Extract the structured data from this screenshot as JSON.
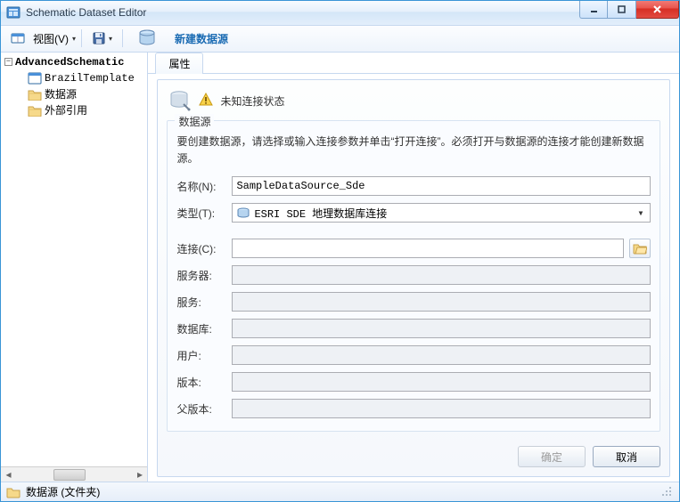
{
  "window": {
    "title": "Schematic Dataset Editor"
  },
  "toolbar": {
    "view_label": "视图(V)",
    "new_datasource": "新建数据源"
  },
  "tree": {
    "root": {
      "label": "AdvancedSchematic"
    },
    "items": [
      {
        "label": "BrazilTemplate",
        "icon": "template"
      },
      {
        "label": "数据源",
        "icon": "folder"
      },
      {
        "label": "外部引用",
        "icon": "folder"
      }
    ]
  },
  "tab": {
    "label": "属性"
  },
  "panel": {
    "status_text": "未知连接状态",
    "group_title": "数据源",
    "instruction": "要创建数据源，请选择或输入连接参数并单击“打开连接”。必须打开与数据源的连接才能创建新数据源。",
    "fields": {
      "name_label": "名称(N):",
      "name_value": "SampleDataSource_Sde",
      "type_label": "类型(T):",
      "type_value": "ESRI SDE 地理数据库连接",
      "conn_label": "连接(C):",
      "conn_value": "",
      "server_label": "服务器:",
      "service_label": "服务:",
      "database_label": "数据库:",
      "user_label": "用户:",
      "version_label": "版本:",
      "parentver_label": "父版本:"
    },
    "buttons": {
      "ok": "确定",
      "cancel": "取消"
    }
  },
  "statusbar": {
    "text": "数据源 (文件夹)"
  }
}
